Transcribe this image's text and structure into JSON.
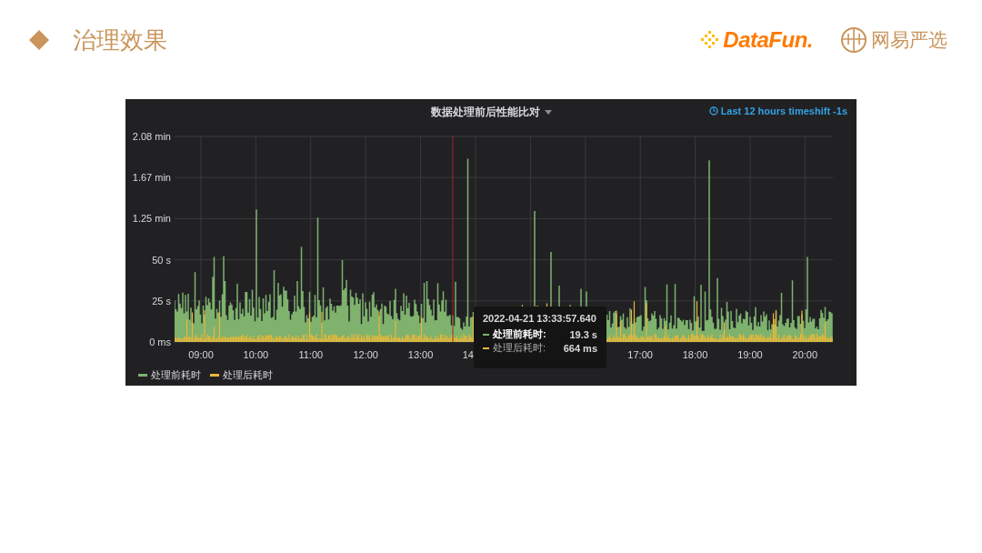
{
  "slide": {
    "title": "治理效果",
    "logos": [
      {
        "kind": "datafun",
        "text": "DataFun."
      },
      {
        "kind": "yanxuan",
        "text": "网易严选"
      }
    ]
  },
  "panel": {
    "title": "数据处理前后性能比对",
    "time_range": "Last 12 hours timeshift -1s",
    "y_axis": [
      "2.08 min",
      "1.67 min",
      "1.25 min",
      "50 s",
      "25 s",
      "0 ms"
    ],
    "x_axis": [
      "09:00",
      "10:00",
      "11:00",
      "12:00",
      "13:00",
      "14",
      "17:00",
      "18:00",
      "19:00",
      "20:00"
    ],
    "legend": [
      {
        "name": "处理前耗时",
        "color": "#7eb26d"
      },
      {
        "name": "处理后耗时",
        "color": "#eab839"
      }
    ],
    "tooltip": {
      "time": "2022-04-21 13:33:57.640",
      "rows": [
        {
          "name": "处理前耗时:",
          "value": "19.3 s",
          "color": "#7eb26d",
          "selected": true
        },
        {
          "name": "处理后耗时:",
          "value": "664 ms",
          "color": "#eab839",
          "selected": false
        }
      ]
    }
  }
}
